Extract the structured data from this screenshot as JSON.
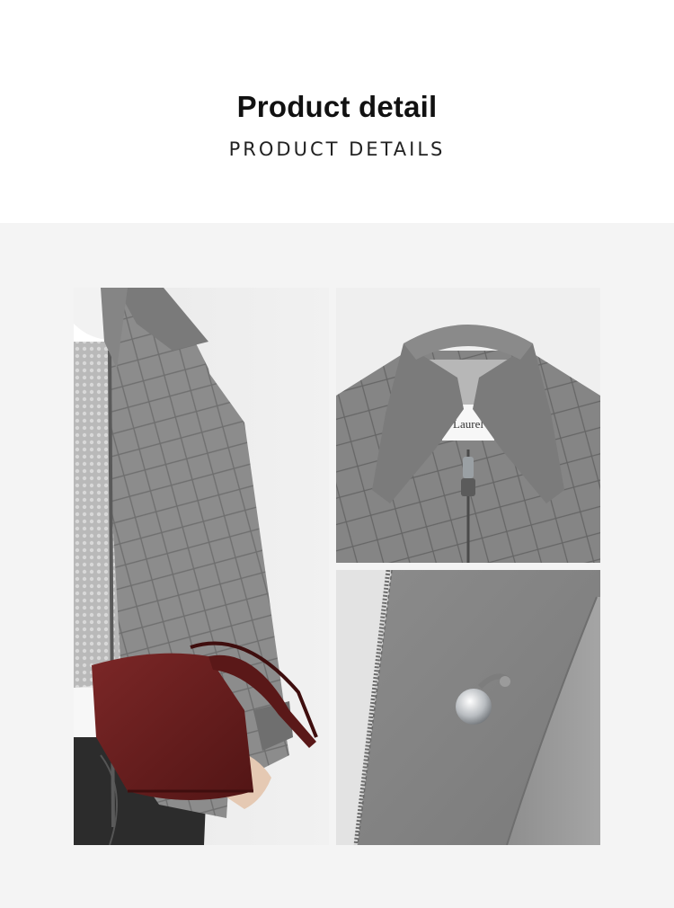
{
  "header": {
    "title": "Product detail",
    "subtitle": "PRODUCT DETAILS"
  },
  "gallery": {
    "brand_label": "Laurel",
    "icons": [
      "model-photo",
      "collar-closeup-photo",
      "button-closeup-photo"
    ]
  },
  "colors": {
    "page_background": "#ffffff",
    "gallery_background": "#f4f4f4",
    "jacket_grey": "#8a8a8a",
    "bag_burgundy": "#6e1f1f",
    "title_text": "#111111"
  }
}
